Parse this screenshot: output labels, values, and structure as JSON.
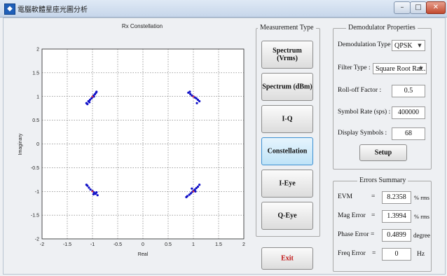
{
  "window": {
    "title": "電腦軟體星座光圖分析",
    "icon": "matlab-figure-icon",
    "buttons": {
      "minimize": "–",
      "maximize": "□",
      "close": "✕"
    }
  },
  "measurement": {
    "legend": "Measurement Type",
    "buttons": [
      {
        "label": "Spectrum (Vrms)",
        "active": false
      },
      {
        "label": "Spectrum (dBm)",
        "active": false
      },
      {
        "label": "I-Q",
        "active": false
      },
      {
        "label": "Constellation",
        "active": true
      },
      {
        "label": "I-Eye",
        "active": false
      },
      {
        "label": "Q-Eye",
        "active": false
      }
    ]
  },
  "exit_label": "Exit",
  "demod": {
    "legend": "Demodulator Properties",
    "demod_type_label": "Demodulation Type :",
    "demod_type_value": "QPSK",
    "filter_type_label": "Filter Type :",
    "filter_type_value": "Square Root Rai...",
    "rolloff_label": "Roll-off Factor :",
    "rolloff_value": "0.5",
    "symbol_rate_label": "Symbol Rate (sps) :",
    "symbol_rate_value": "400000",
    "display_symbols_label": "Display Symbols :",
    "display_symbols_value": "68",
    "setup_label": "Setup"
  },
  "errors": {
    "legend": "Errors Summary",
    "rows": [
      {
        "label": "EVM",
        "eq": "=",
        "value": "8.2358",
        "unit": "% rms"
      },
      {
        "label": "Mag Error",
        "eq": "=",
        "value": "1.3994",
        "unit": "% rms"
      },
      {
        "label": "Phase Error =",
        "eq": "",
        "value": "0.4899",
        "unit": "degree"
      },
      {
        "label": "Freq Error",
        "eq": "=",
        "value": "0",
        "unit": "Hz"
      }
    ]
  },
  "chart_data": {
    "type": "scatter",
    "title": "Rx Constellation",
    "xlabel": "Real",
    "ylabel": "Imaginary",
    "xlim": [
      -2,
      2
    ],
    "ylim": [
      -2,
      2
    ],
    "xticks": [
      "-2",
      "-1.5",
      "-1",
      "-0.5",
      "0",
      "0.5",
      "1",
      "1.5",
      "2"
    ],
    "yticks": [
      "2",
      "1.5",
      "1",
      "0.5",
      "0",
      "-0.5",
      "-1",
      "-1.5",
      "-2"
    ],
    "grid": true,
    "series": [
      {
        "color": "#1010c8",
        "points": [
          [
            -1.12,
            0.86
          ],
          [
            -1.08,
            0.9
          ],
          [
            -1.05,
            0.93
          ],
          [
            -1.02,
            0.96
          ],
          [
            -1.0,
            0.99
          ],
          [
            -0.98,
            1.02
          ],
          [
            -0.95,
            1.05
          ],
          [
            -0.93,
            1.08
          ],
          [
            -1.06,
            0.88
          ],
          [
            -0.97,
            1.0
          ],
          [
            -0.92,
            1.1
          ],
          [
            -1.1,
            0.84
          ],
          [
            0.9,
            1.08
          ],
          [
            0.94,
            1.05
          ],
          [
            0.97,
            1.02
          ],
          [
            1.0,
            1.0
          ],
          [
            1.03,
            0.98
          ],
          [
            1.06,
            0.96
          ],
          [
            1.09,
            0.93
          ],
          [
            0.93,
            1.1
          ],
          [
            1.12,
            0.9
          ],
          [
            1.07,
            0.86
          ],
          [
            -1.1,
            -0.88
          ],
          [
            -1.07,
            -0.92
          ],
          [
            -1.04,
            -0.96
          ],
          [
            -1.0,
            -0.99
          ],
          [
            -0.97,
            -1.02
          ],
          [
            -0.94,
            -1.05
          ],
          [
            -0.9,
            -1.08
          ],
          [
            -1.12,
            -0.86
          ],
          [
            -0.98,
            -1.06
          ],
          [
            -0.92,
            -1.02
          ],
          [
            0.88,
            -1.1
          ],
          [
            0.92,
            -1.07
          ],
          [
            0.95,
            -1.04
          ],
          [
            0.98,
            -1.01
          ],
          [
            1.0,
            -0.99
          ],
          [
            1.03,
            -0.96
          ],
          [
            1.06,
            -0.93
          ],
          [
            1.09,
            -0.9
          ],
          [
            1.12,
            -0.86
          ],
          [
            0.86,
            -1.12
          ],
          [
            1.04,
            -1.0
          ],
          [
            0.97,
            -0.94
          ]
        ]
      },
      {
        "color": "#e0303a",
        "points": [
          [
            -1.0,
            1.0
          ],
          [
            1.0,
            1.0
          ],
          [
            -1.0,
            -1.0
          ],
          [
            1.0,
            -1.0
          ]
        ]
      }
    ]
  }
}
